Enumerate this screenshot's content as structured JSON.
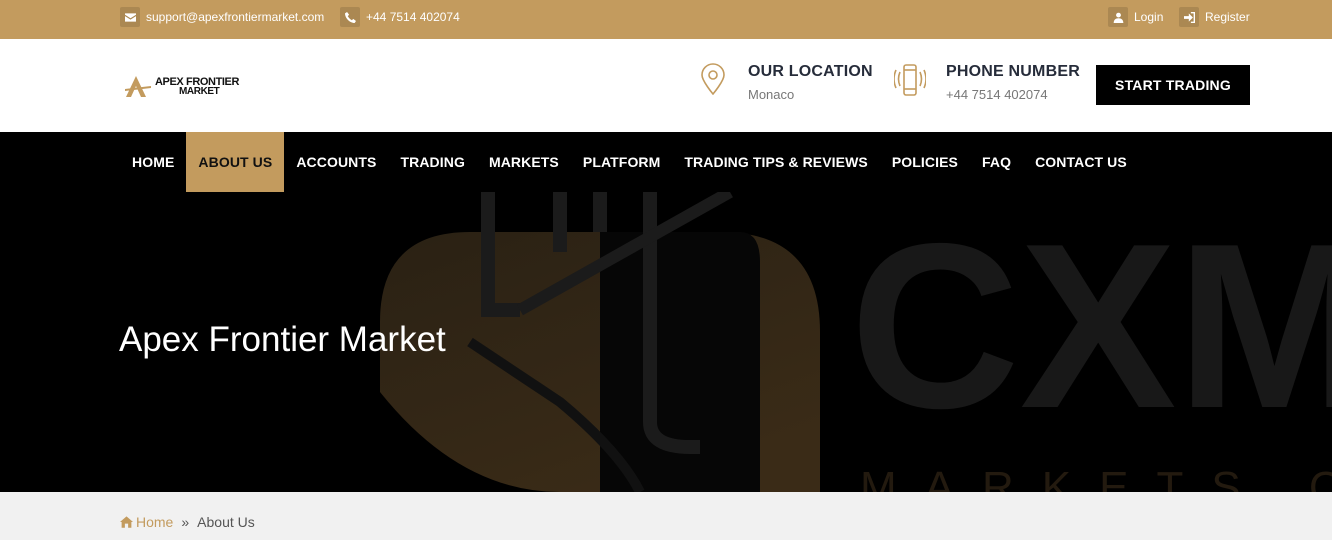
{
  "topbar": {
    "email": "support@apexfrontiermarket.com",
    "phone": "+44 7514 402074",
    "login_label": "Login",
    "register_label": "Register"
  },
  "header": {
    "logo_line1": "APEX FRONTIER",
    "logo_line2": "MARKET",
    "location_title": "OUR LOCATION",
    "location_value": "Monaco",
    "phone_title": "PHONE NUMBER",
    "phone_value": "+44 7514 402074",
    "cta_label": "START TRADING"
  },
  "nav": {
    "items": [
      {
        "label": "HOME"
      },
      {
        "label": "ABOUT US"
      },
      {
        "label": "ACCOUNTS"
      },
      {
        "label": "TRADING"
      },
      {
        "label": "MARKETS"
      },
      {
        "label": "PLATFORM"
      },
      {
        "label": "TRADING TIPS & REVIEWS"
      },
      {
        "label": "POLICIES"
      },
      {
        "label": "FAQ"
      },
      {
        "label": "CONTACT US"
      }
    ],
    "active_index": 1
  },
  "hero": {
    "title": "Apex Frontier Market",
    "watermark_main": "CXM",
    "watermark_sub": "MARKETS CO"
  },
  "breadcrumb": {
    "home_label": "Home",
    "current_label": "About Us"
  },
  "colors": {
    "accent": "#c39b5e",
    "dark": "#000000",
    "text_dark": "#262c3a"
  },
  "icons": {
    "email": "envelope-icon",
    "phone": "phone-icon",
    "login": "user-icon",
    "register": "sign-in-icon",
    "location": "map-pin-icon",
    "mobile": "mobile-phone-icon",
    "home": "home-icon",
    "separator": "double-chevron-right-icon"
  }
}
